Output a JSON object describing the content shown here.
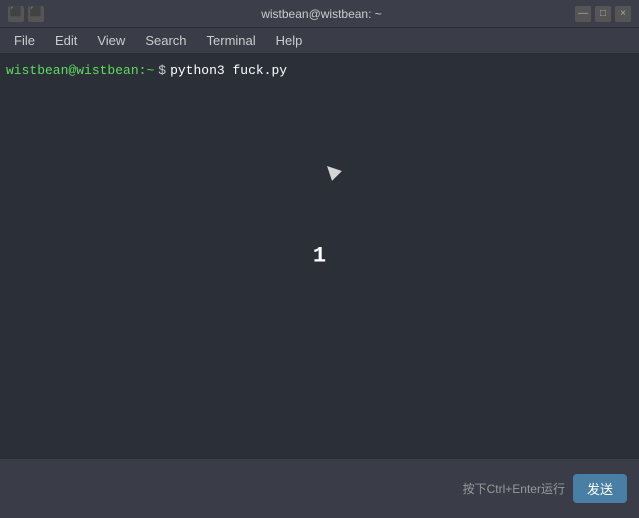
{
  "titlebar": {
    "title": "wistbean@wistbean: ~",
    "controls": {
      "minimize": "—",
      "maximize": "□",
      "close": "×"
    }
  },
  "menubar": {
    "items": [
      {
        "label": "File"
      },
      {
        "label": "Edit"
      },
      {
        "label": "View"
      },
      {
        "label": "Search"
      },
      {
        "label": "Terminal"
      },
      {
        "label": "Help"
      }
    ]
  },
  "terminal": {
    "prompt_user": "wistbean@wistbean:",
    "prompt_path": "~",
    "prompt_dollar": "$",
    "command": "python3 fuck.py",
    "output": "1"
  },
  "bottom": {
    "hint": "按下Ctrl+Enter运行",
    "send_label": "发送"
  }
}
